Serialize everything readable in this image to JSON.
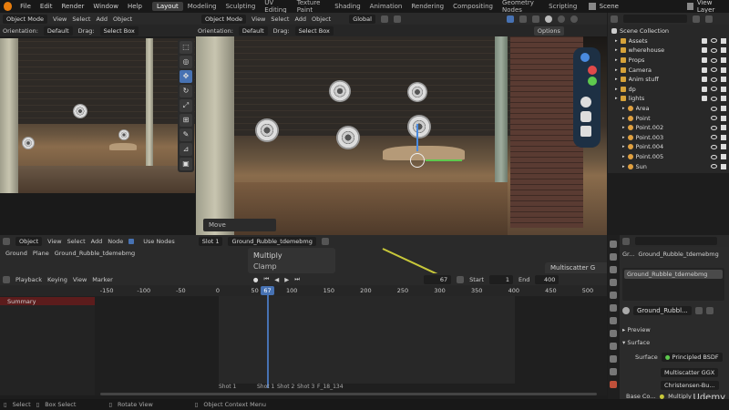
{
  "topbar": {
    "menus": [
      "File",
      "Edit",
      "Render",
      "Window",
      "Help"
    ],
    "workspaces": [
      "Layout",
      "Modeling",
      "Sculpting",
      "UV Editing",
      "Texture Paint",
      "Shading",
      "Animation",
      "Rendering",
      "Compositing",
      "Geometry Nodes",
      "Scripting"
    ],
    "active_workspace": "Layout",
    "scene": "Scene",
    "view_layer": "View Layer"
  },
  "left_viewport": {
    "mode": "Object Mode",
    "menus": [
      "View",
      "Select",
      "Add",
      "Object"
    ],
    "orientation_label": "Orientation:",
    "orientation_value": "Default",
    "drag_label": "Drag:",
    "drag_value": "Select Box"
  },
  "main_viewport": {
    "mode": "Object Mode",
    "menus": [
      "View",
      "Select",
      "Add",
      "Object"
    ],
    "transform": "Global",
    "orientation_label": "Orientation:",
    "orientation_value": "Default",
    "drag_label": "Drag:",
    "drag_value": "Select Box",
    "options": "Options",
    "operator_panel": "Move"
  },
  "outliner": {
    "title": "Scene Collection",
    "items": [
      "Assets",
      "wherehouse",
      "Props",
      "Camera",
      "Anim stuff",
      "dp",
      "lights",
      "Area",
      "Point",
      "Point.002",
      "Point.003",
      "Point.004",
      "Point.005",
      "Sun"
    ]
  },
  "node_editor": {
    "mode": "Object",
    "menus": [
      "View",
      "Select",
      "Add",
      "Node"
    ],
    "use_nodes": "Use Nodes",
    "slot": "Slot 1",
    "material": "Ground_Rubble_tdemebmg",
    "breadcrumb": [
      "Ground",
      "Plane",
      "Ground_Rubble_tdemebmg"
    ],
    "node_multiply": "Multiply",
    "node_clamp": "Clamp",
    "multiscatter": "Multiscatter G"
  },
  "timeline": {
    "menus": [
      "Playback",
      "Keying",
      "View",
      "Marker"
    ],
    "current_frame": "67",
    "start_label": "Start",
    "start": "1",
    "end_label": "End",
    "end": "400",
    "summary": "Summary",
    "ticks": [
      "-150",
      "-100",
      "-50",
      "0",
      "50",
      "67",
      "100",
      "150",
      "200",
      "250",
      "300",
      "350",
      "400",
      "450",
      "500"
    ],
    "markers": [
      "Shot 1",
      "Shot 1",
      "Shot 2",
      "Shot 3",
      "F_18_134"
    ]
  },
  "properties": {
    "object": "Gr...",
    "material_name": "Ground_Rubble_tdemebmg",
    "slot_name": "Ground_Rubble_tdemebmg",
    "short_name": "Ground_Rubbl...",
    "preview": "Preview",
    "surface_section": "Surface",
    "surface_label": "Surface",
    "surface_value": "Principled BSDF",
    "distribution": "Multiscatter GGX",
    "subsurface": "Christensen-Bu...",
    "base_color_label": "Base Co...",
    "base_color_value": "Multiply"
  },
  "status_bar": {
    "items": [
      "Select",
      "Box Select",
      "Rotate View",
      "Object Context Menu"
    ]
  },
  "watermark": "Udemy",
  "colors": {
    "accent": "#4772b3",
    "playhead": "#4772b3",
    "summary": "#5c1c1c"
  }
}
